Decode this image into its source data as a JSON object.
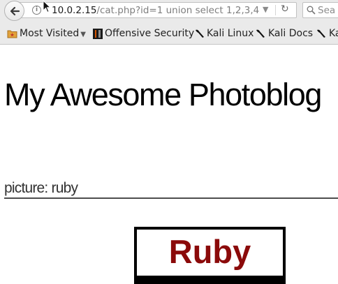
{
  "browser": {
    "url": {
      "host": "10.0.2.15",
      "path": "/cat.php?id=1 union select 1,2,3,4"
    },
    "search": {
      "placeholder": "Sea"
    },
    "bookmarks": [
      {
        "label": "Most Visited",
        "icon": "folder-star-icon",
        "has_menu": true
      },
      {
        "label": "Offensive Security",
        "icon": "offsec-icon"
      },
      {
        "label": "Kali Linux",
        "icon": "kali-dragon-icon"
      },
      {
        "label": "Kali Docs",
        "icon": "kali-dragon-icon"
      },
      {
        "label": "Ka",
        "icon": "kali-dragon-icon"
      }
    ]
  },
  "page": {
    "title": "My Awesome Photoblog",
    "caption": "picture: ruby",
    "image_word": "Ruby"
  },
  "colors": {
    "ruby_red": "#8b0a0a",
    "chrome_bg": "#eaeaea"
  }
}
